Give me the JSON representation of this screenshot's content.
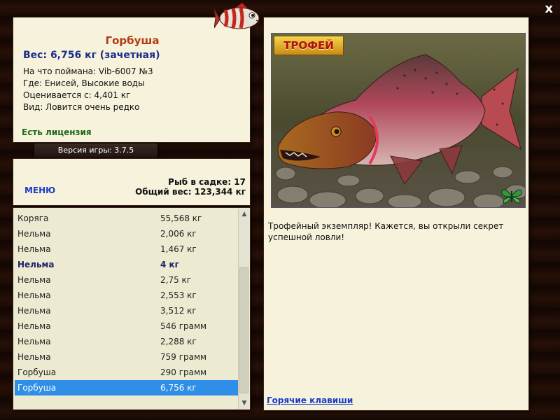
{
  "close_label": "x",
  "info": {
    "title": "Горбуша",
    "weight": "Вес: 6,756 кг (зачетная)",
    "lines": [
      "На что поймана: Vib-6007 №3",
      "Где: Енисей, Высокие воды",
      "Оценивается с: 4,401 кг",
      "Вид: Ловится очень редко"
    ],
    "license": "Есть лицензия"
  },
  "version": "Версия игры: 3.7.5",
  "menu": {
    "menu_label": "МЕНЮ",
    "fish_count": "Рыб в садке: 17",
    "total_weight": "Общий вес: 123,344 кг"
  },
  "catch_list": [
    {
      "name": "Коряга",
      "weight": "55,568 кг",
      "bold": false,
      "selected": false
    },
    {
      "name": "Нельма",
      "weight": "2,006 кг",
      "bold": false,
      "selected": false
    },
    {
      "name": "Нельма",
      "weight": "1,467 кг",
      "bold": false,
      "selected": false
    },
    {
      "name": "Нельма",
      "weight": "4 кг",
      "bold": true,
      "selected": false
    },
    {
      "name": "Нельма",
      "weight": "2,75 кг",
      "bold": false,
      "selected": false
    },
    {
      "name": "Нельма",
      "weight": "2,553 кг",
      "bold": false,
      "selected": false
    },
    {
      "name": "Нельма",
      "weight": "3,512 кг",
      "bold": false,
      "selected": false
    },
    {
      "name": "Нельма",
      "weight": "546 грамм",
      "bold": false,
      "selected": false
    },
    {
      "name": "Нельма",
      "weight": "2,288 кг",
      "bold": false,
      "selected": false
    },
    {
      "name": "Нельма",
      "weight": "759 грамм",
      "bold": false,
      "selected": false
    },
    {
      "name": "Горбуша",
      "weight": "290 грамм",
      "bold": false,
      "selected": false
    },
    {
      "name": "Горбуша",
      "weight": "6,756 кг",
      "bold": false,
      "selected": true
    }
  ],
  "trophy_badge": "ТРОФЕЙ",
  "description": "Трофейный экземпляр! Кажется, вы открыли секрет успешной ловли!",
  "hotkeys_label": "Горячие клавиши",
  "icons": {
    "close": "close-icon",
    "logo": "fish-logo-icon",
    "butterfly": "butterfly-icon",
    "scroll_up": "chevron-up-icon",
    "scroll_down": "chevron-down-icon"
  },
  "colors": {
    "title": "#b33a12",
    "weight": "#1a2e8a",
    "license": "#1d6a1a",
    "link": "#1a3cc8",
    "selection": "#2f8ee8",
    "panel": "#f6f2dc"
  }
}
